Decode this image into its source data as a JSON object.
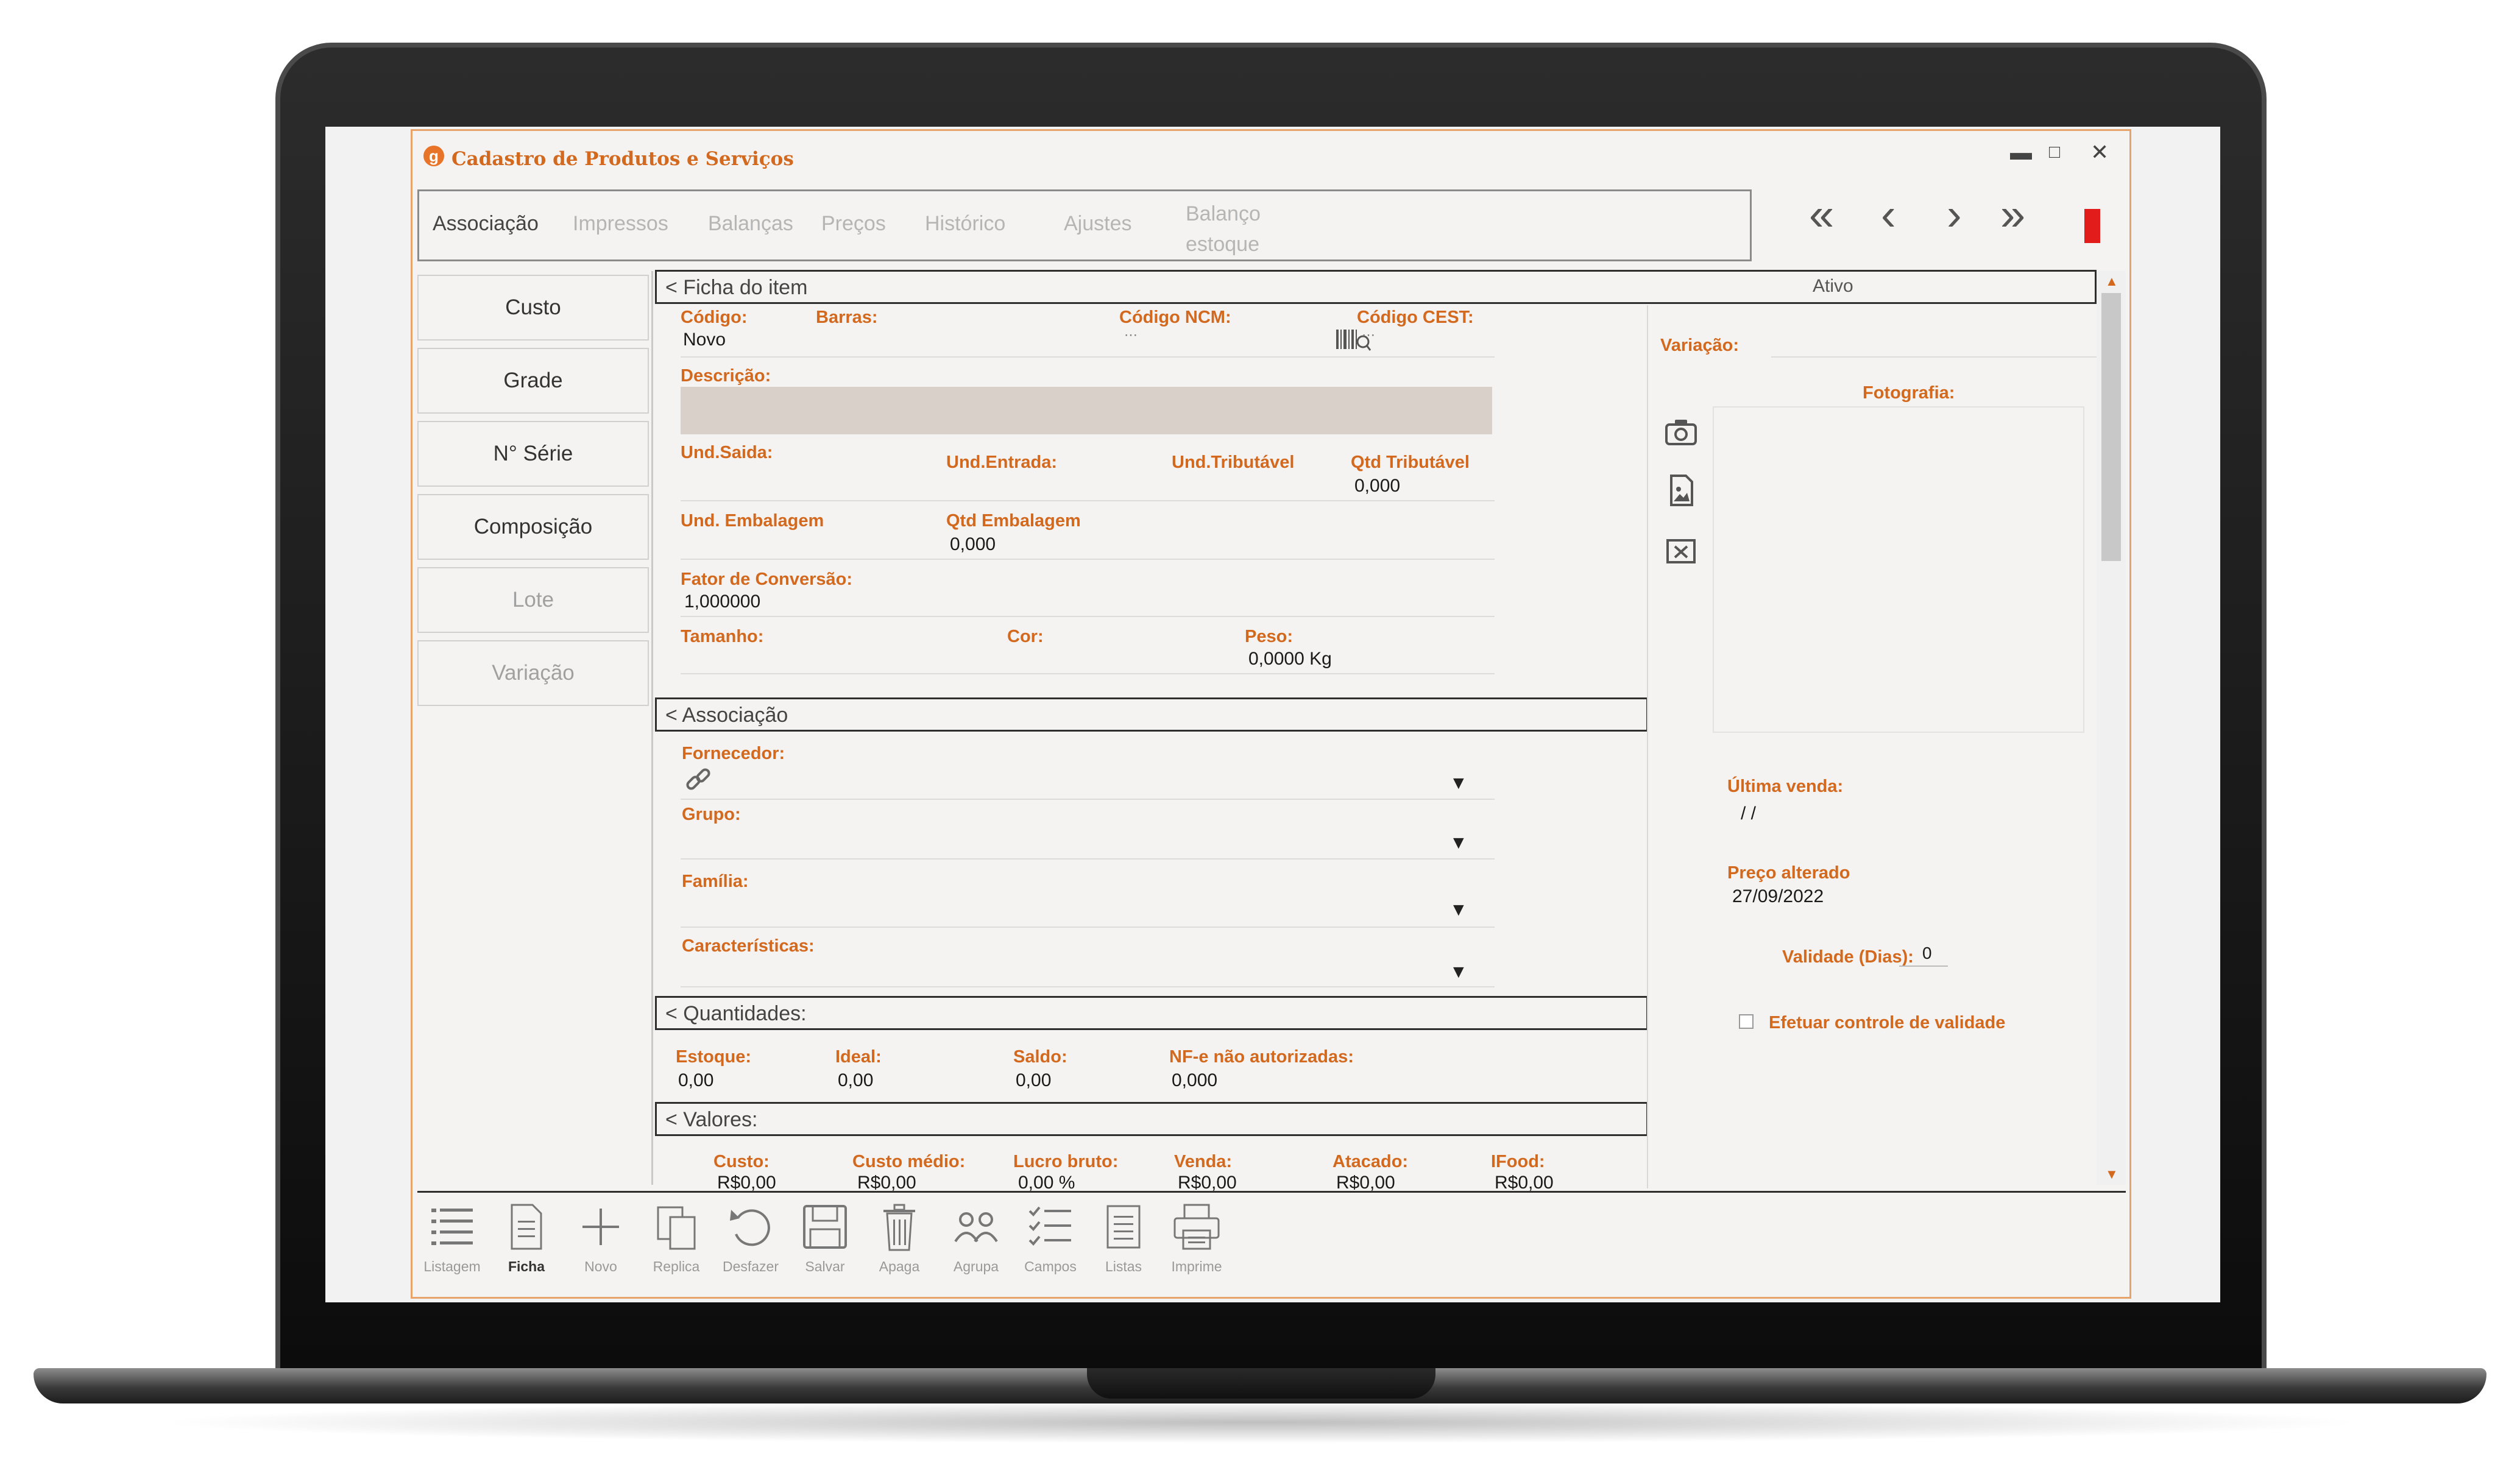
{
  "window": {
    "title": "Cadastro de Produtos e Serviços",
    "logo_letter": "g"
  },
  "tabs": [
    {
      "label": "Associação",
      "active": true
    },
    {
      "label": "Impressos",
      "active": false
    },
    {
      "label": "Balanças",
      "active": false
    },
    {
      "label": "Preços",
      "active": false
    },
    {
      "label": "Histórico",
      "active": false
    },
    {
      "label": "Ajustes",
      "active": false
    },
    {
      "label": "Balanço estoque",
      "active": false
    }
  ],
  "side_buttons": [
    {
      "label": "Custo",
      "enabled": true
    },
    {
      "label": "Grade",
      "enabled": true
    },
    {
      "label": "N° Série",
      "enabled": true
    },
    {
      "label": "Composição",
      "enabled": true
    },
    {
      "label": "Lote",
      "enabled": false
    },
    {
      "label": "Variação",
      "enabled": false
    }
  ],
  "ficha": {
    "header": "< Ficha do item",
    "status": "Ativo",
    "codigo_label": "Código:",
    "codigo_value": "Novo",
    "barras_label": "Barras:",
    "ncm_label": "Código NCM:",
    "cest_label": "Código CEST:",
    "descricao_label": "Descrição:",
    "und_saida_label": "Und.Saida:",
    "und_entrada_label": "Und.Entrada:",
    "und_tributavel_label": "Und.Tributável",
    "qtd_tributavel_label": "Qtd Tributável",
    "qtd_tributavel_value": "0,000",
    "und_embalagem_label": "Und. Embalagem",
    "qtd_embalagem_label": "Qtd Embalagem",
    "qtd_embalagem_value": "0,000",
    "fator_label": "Fator de Conversão:",
    "fator_value": "1,000000",
    "tamanho_label": "Tamanho:",
    "cor_label": "Cor:",
    "peso_label": "Peso:",
    "peso_value": "0,0000 Kg"
  },
  "associacao": {
    "header": "< Associação",
    "fornecedor_label": "Fornecedor:",
    "grupo_label": "Grupo:",
    "familia_label": "Família:",
    "caracteristicas_label": "Características:"
  },
  "quantidades": {
    "header": "< Quantidades:",
    "estoque_label": "Estoque:",
    "estoque_value": "0,00",
    "ideal_label": "Ideal:",
    "ideal_value": "0,00",
    "saldo_label": "Saldo:",
    "saldo_value": "0,00",
    "nfe_label": "NF-e não autorizadas:",
    "nfe_value": "0,000"
  },
  "valores": {
    "header": "< Valores:",
    "items": [
      {
        "label": "Custo:",
        "value": "R$0,00"
      },
      {
        "label": "Custo médio:",
        "value": "R$0,00"
      },
      {
        "label": "Lucro bruto:",
        "value": "0,00 %"
      },
      {
        "label": "Venda:",
        "value": "R$0,00"
      },
      {
        "label": "Atacado:",
        "value": "R$0,00"
      },
      {
        "label": "IFood:",
        "value": "R$0,00"
      }
    ]
  },
  "right_panel": {
    "variacao_label": "Variação:",
    "fotografia_label": "Fotografia:",
    "ultima_venda_label": "Última venda:",
    "ultima_venda_value": "/ /",
    "preco_alterado_label": "Preço alterado",
    "preco_alterado_value": "27/09/2022",
    "validade_label": "Validade (Dias):",
    "validade_value": "0",
    "controle_validade_label": "Efetuar controle de validade"
  },
  "toolbar": [
    {
      "label": "Listagem",
      "icon": "list-icon"
    },
    {
      "label": "Ficha",
      "icon": "document-icon",
      "selected": true
    },
    {
      "label": "Novo",
      "icon": "plus-icon"
    },
    {
      "label": "Replica",
      "icon": "copy-icon"
    },
    {
      "label": "Desfazer",
      "icon": "undo-icon"
    },
    {
      "label": "Salvar",
      "icon": "save-icon"
    },
    {
      "label": "Apaga",
      "icon": "trash-icon"
    },
    {
      "label": "Agrupa",
      "icon": "group-icon"
    },
    {
      "label": "Campos",
      "icon": "checklist-icon"
    },
    {
      "label": "Listas",
      "icon": "lists-icon"
    },
    {
      "label": "Imprime",
      "icon": "printer-icon"
    }
  ],
  "colors": {
    "accent": "#d2691e",
    "window_border": "#e6a36b",
    "status_red": "#e21b1b"
  }
}
